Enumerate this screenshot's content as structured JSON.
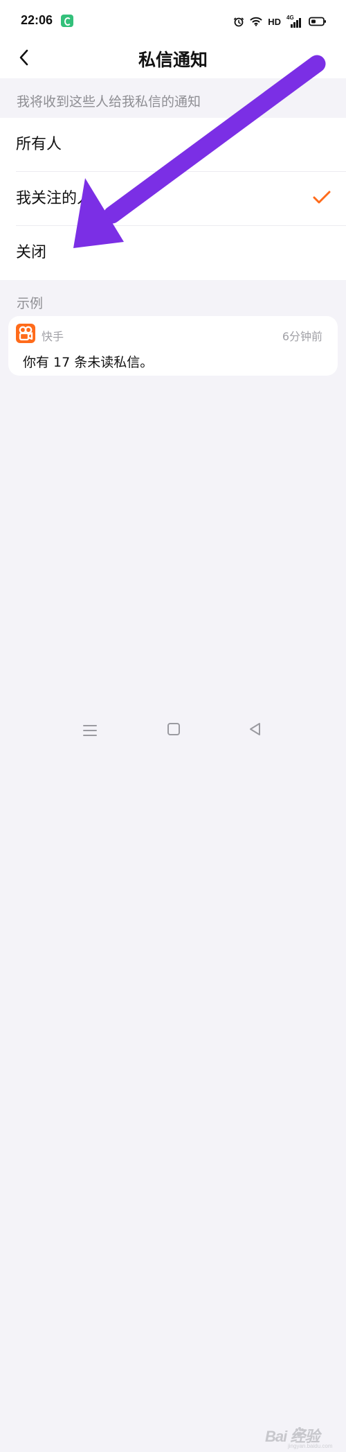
{
  "status_bar": {
    "time": "22:06",
    "app_badge": "green-notification-icon",
    "network_text": "HD",
    "signal_text": "4G"
  },
  "header": {
    "title": "私信通知",
    "back_icon": "chevron-left-icon"
  },
  "settings": {
    "caption": "我将收到这些人给我私信的通知",
    "options": [
      {
        "label": "所有人",
        "selected": false
      },
      {
        "label": "我关注的人",
        "selected": true
      },
      {
        "label": "关闭",
        "selected": false
      }
    ],
    "check_icon": "checkmark-icon"
  },
  "example": {
    "caption": "示例",
    "app_name": "快手",
    "time": "6分钟前",
    "message": "你有 17 条未读私信。",
    "app_icon": "kuaishou-app-icon"
  },
  "annotation": {
    "type": "purple-arrow",
    "color": "#7b2fe5"
  },
  "navigation": {
    "items": [
      "menu-icon",
      "home-square-icon",
      "back-triangle-icon"
    ]
  },
  "watermark": {
    "text": "Bai 经验",
    "url": "jingyan.baidu.com"
  },
  "colors": {
    "background": "#f4f3f8",
    "surface": "#ffffff",
    "accent": "#ff6b1a",
    "caption": "#8e8e93",
    "arrow": "#7b2fe5"
  }
}
